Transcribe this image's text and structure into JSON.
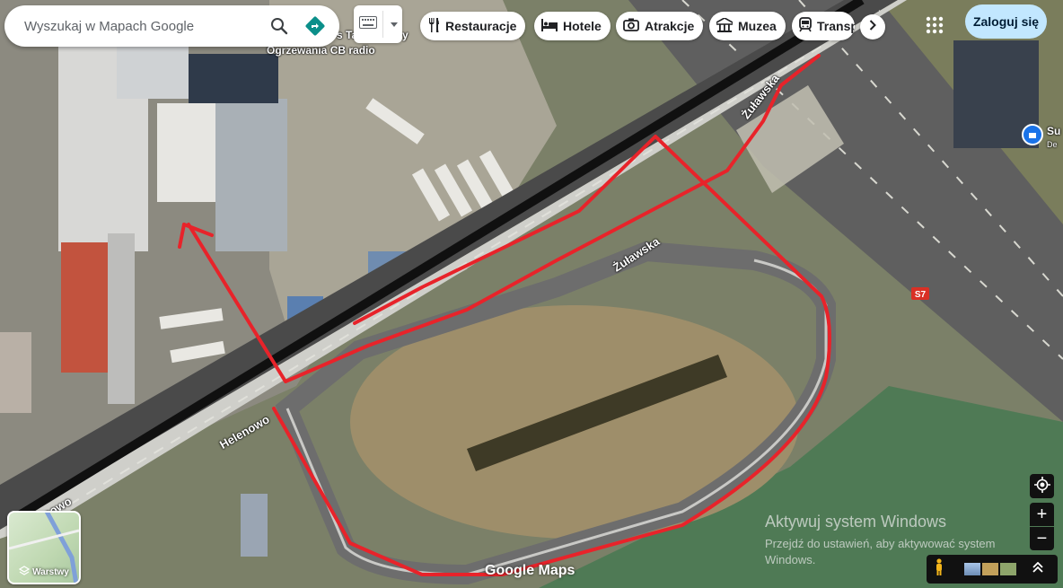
{
  "search": {
    "placeholder": "Wyszukaj w Mapach Google"
  },
  "categories": [
    {
      "label": "Restauracje",
      "icon": "fork-knife-icon"
    },
    {
      "label": "Hotele",
      "icon": "bed-icon"
    },
    {
      "label": "Atrakcje",
      "icon": "camera-icon"
    },
    {
      "label": "Muzea",
      "icon": "museum-icon"
    },
    {
      "label": "Transp",
      "icon": "train-icon"
    }
  ],
  "header": {
    "signin_label": "Zaloguj się"
  },
  "map_labels": {
    "poi_partial": "s Ta",
    "poi_partial2": "y",
    "poi_line2": "Ogrzewania CB radio",
    "road_zulawska_upper": "Żuławska",
    "road_zulawska_lower": "Żuławska",
    "road_helenowo": "Helenowo",
    "road_lenowo": "lenowo",
    "highway_badge": "S7",
    "right_poi_partial": "Su",
    "right_poi_partial2": "De"
  },
  "layers": {
    "label": "Warstwy"
  },
  "controls": {
    "zoom_in": "+",
    "zoom_out": "−"
  },
  "attribution": {
    "logo": "Google Maps"
  },
  "watermark": {
    "title": "Aktywuj system Windows",
    "subtitle": "Przejdź do ustawień, aby aktywować system Windows."
  },
  "colors": {
    "route_annotation": "#e8232a",
    "search_accent": "#1a73e8",
    "signin_bg": "#c2e7ff"
  }
}
